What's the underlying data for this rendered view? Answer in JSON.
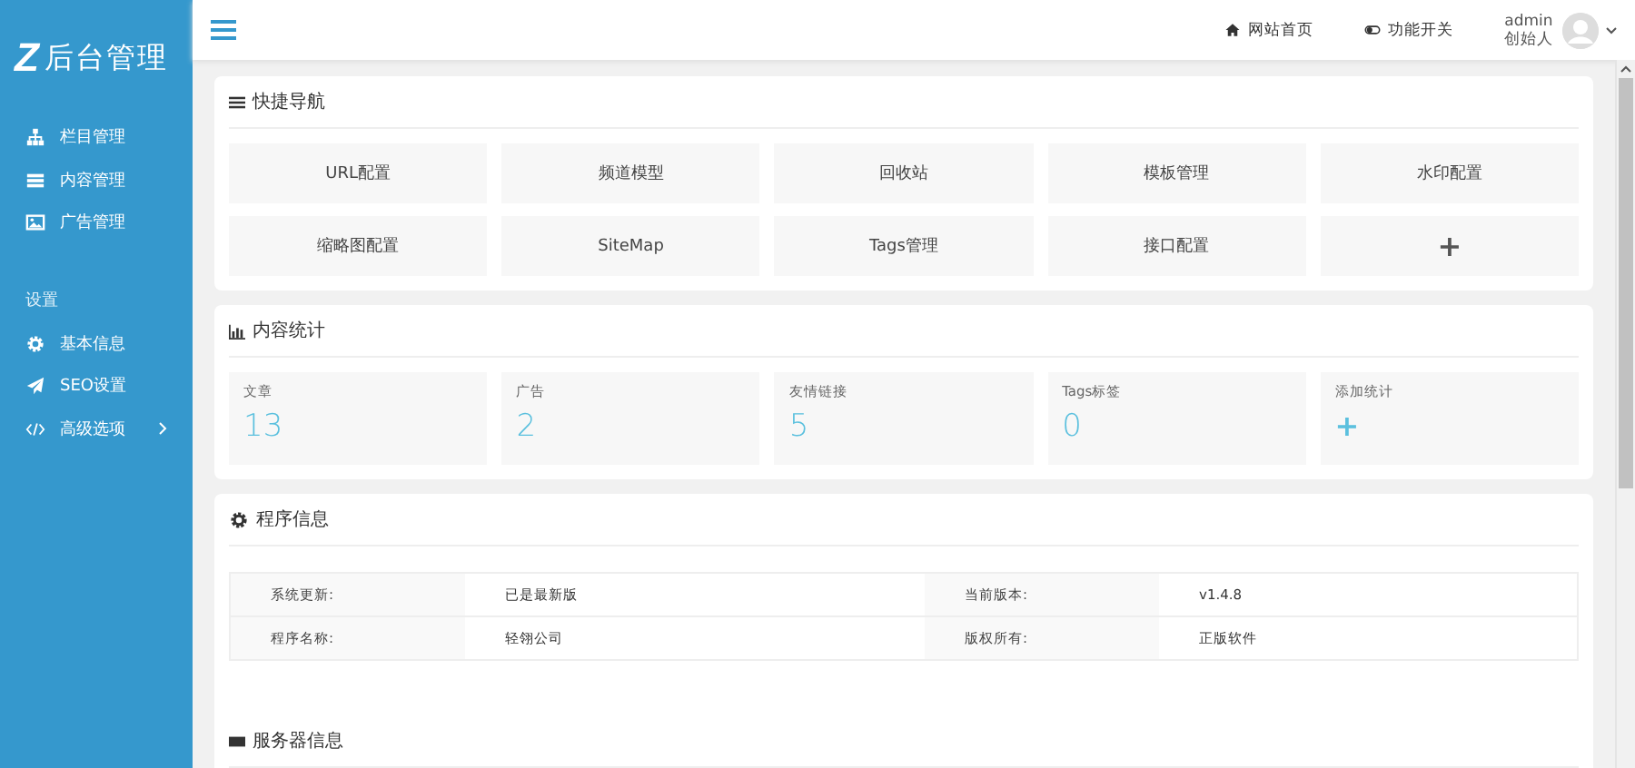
{
  "sidebar": {
    "logo_mark": "Z",
    "logo_text": "后台管理",
    "items": [
      {
        "label": "栏目管理",
        "has_submenu": false
      },
      {
        "label": "内容管理",
        "has_submenu": false
      },
      {
        "label": "广告管理",
        "has_submenu": false
      }
    ],
    "section": "设置",
    "settings_items": [
      {
        "label": "基本信息",
        "has_submenu": false
      },
      {
        "label": "SEO设置",
        "has_submenu": false
      },
      {
        "label": "高级选项",
        "has_submenu": true
      }
    ]
  },
  "topbar": {
    "links": [
      {
        "label": "网站首页"
      },
      {
        "label": "功能开关"
      }
    ],
    "user": {
      "name": "admin",
      "role": "创始人"
    }
  },
  "quick_nav": {
    "title": "快捷导航",
    "buttons": [
      {
        "label": "URL配置",
        "kind": "text"
      },
      {
        "label": "频道模型",
        "kind": "text"
      },
      {
        "label": "回收站",
        "kind": "text"
      },
      {
        "label": "模板管理",
        "kind": "text"
      },
      {
        "label": "水印配置",
        "kind": "text"
      },
      {
        "label": "缩略图配置",
        "kind": "text"
      },
      {
        "label": "SiteMap",
        "kind": "text"
      },
      {
        "label": "Tags管理",
        "kind": "text"
      },
      {
        "label": "接口配置",
        "kind": "text"
      },
      {
        "label": "+",
        "kind": "add"
      }
    ]
  },
  "stats": {
    "title": "内容统计",
    "items": [
      {
        "label": "文章",
        "value": "13",
        "kind": "count"
      },
      {
        "label": "广告",
        "value": "2",
        "kind": "count"
      },
      {
        "label": "友情链接",
        "value": "5",
        "kind": "count"
      },
      {
        "label": "Tags标签",
        "value": "0",
        "kind": "count"
      },
      {
        "label": "添加统计",
        "value": "+",
        "kind": "add"
      }
    ]
  },
  "program_info": {
    "title": "程序信息",
    "rows": [
      [
        {
          "label": "系统更新:",
          "value": "已是最新版"
        },
        {
          "label": "当前版本:",
          "value": "v1.4.8"
        }
      ],
      [
        {
          "label": "程序名称:",
          "value": "轻翎公司"
        },
        {
          "label": "版权所有:",
          "value": "正版软件"
        }
      ]
    ]
  },
  "server_info": {
    "title": "服务器信息"
  }
}
